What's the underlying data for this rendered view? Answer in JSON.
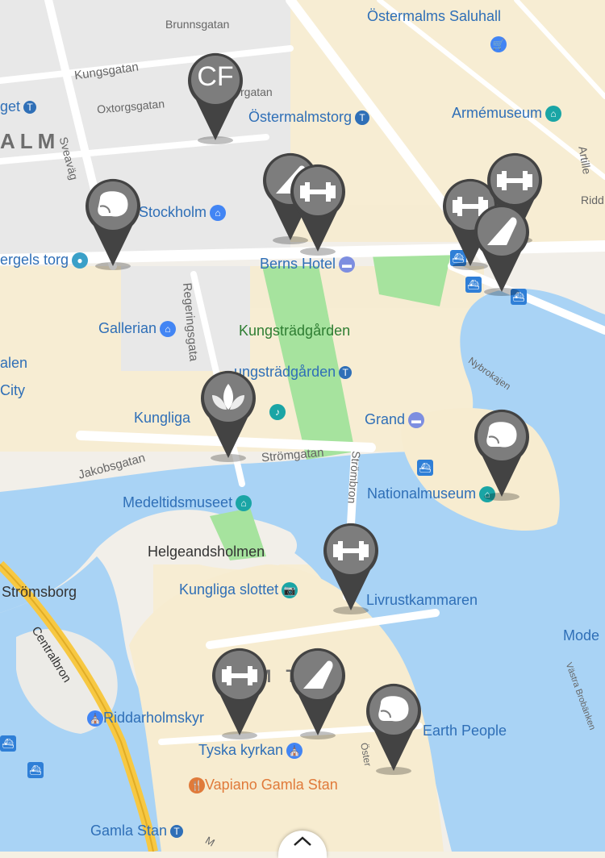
{
  "labels": {
    "ostermalms_saluhall": "Östermalms Saluhall",
    "brunnsgatan": "Brunnsgatan",
    "kungsgatan": "Kungsgatan",
    "oxtorgsgatan": "Oxtorgsgatan",
    "rgatan": "rgatan",
    "ostermalmstorg": "Östermalmstorg",
    "armemuseum": "Armémuseum",
    "get": "get",
    "alm": "ALM",
    "sveavagen": "Sveaväg",
    "stockholm": "Stockholm",
    "sergels_torg": "ergels torg",
    "berns_hotel": "Berns Hotel",
    "gallerian": "Gallerian",
    "regeringsgatan": "Regeringsgata",
    "kungstradgarden": "Kungsträdgården",
    "kungstradgarden_station": "ungsträdgården",
    "nybrokajen": "Nybrokajen",
    "alen": "alen",
    "city": "City",
    "kungliga": "Kungliga",
    "grand": "Grand",
    "jakobsgatan": "Jakobsgatan",
    "strombron_street": "Strömgatan",
    "strombron": "Strömbron",
    "nationalmuseum": "Nationalmuseum",
    "medeltidsmuseet": "Medeltidsmuseet",
    "helgeandsholmen": "Helgeandsholmen",
    "stromsborg": "Strömsborg",
    "kungliga_slottet": "Kungliga slottet",
    "livrustkammaren": "Livrustkammaren",
    "mode": "Mode",
    "centralbron": "Centralbron",
    "mstan": "M TAN",
    "riddarholmskyrkan": "Riddarholmskyr",
    "earth_people": "Earth People",
    "tyska_kyrkan": "Tyska kyrkan",
    "vastra_brobanken": "Västra Brobänken",
    "vapiano": "Vapiano Gamla Stan",
    "gamla_stan": "Gamla Stan",
    "artille": "Artille",
    "ridd": "Ridd",
    "ostert": "Öster",
    "m": "M"
  },
  "pins": [
    {
      "id": "pin-crossfit",
      "type": "crossfit",
      "text": "CF"
    },
    {
      "id": "pin-boxing-sergels",
      "type": "boxing"
    },
    {
      "id": "pin-climbing-1",
      "type": "climbing"
    },
    {
      "id": "pin-gym-1",
      "type": "gym"
    },
    {
      "id": "pin-gym-2",
      "type": "gym"
    },
    {
      "id": "pin-gym-3",
      "type": "gym"
    },
    {
      "id": "pin-running-1",
      "type": "running"
    },
    {
      "id": "pin-yoga",
      "type": "yoga"
    },
    {
      "id": "pin-boxing-nationalmuseum",
      "type": "boxing"
    },
    {
      "id": "pin-gym-4",
      "type": "gym"
    },
    {
      "id": "pin-gym-5",
      "type": "gym"
    },
    {
      "id": "pin-running-2",
      "type": "running"
    },
    {
      "id": "pin-boxing-gamla",
      "type": "boxing"
    }
  ],
  "colors": {
    "water": "#a9d3f5",
    "land": "#f5f0e3",
    "block": "#ecebe7",
    "road": "#ffffff",
    "park": "#a6e39e",
    "pin": "#434343",
    "pin_inner": "#7d7d7d",
    "poi": "#2f6fb7"
  },
  "expand_icon": "chevron-up-icon"
}
